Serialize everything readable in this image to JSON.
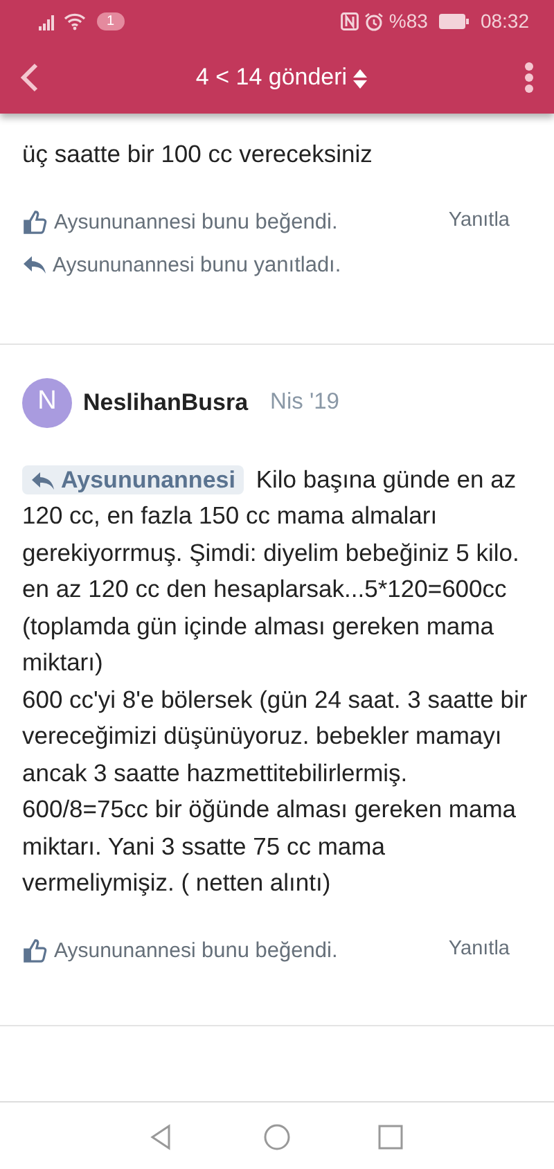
{
  "status_bar": {
    "notification_count": "1",
    "battery": "%83",
    "time": "08:32"
  },
  "header": {
    "title": "4 < 14 gönderi"
  },
  "posts": [
    {
      "kind": "partial",
      "body": "üç saatte bir 100 cc vereceksiniz",
      "likes": {
        "user": "Aysununannesi",
        "text": "bunu beğendi."
      },
      "reply_label": "Yanıtla",
      "replied": {
        "user": "Aysununannesi",
        "text": "bunu yanıtladı."
      }
    },
    {
      "kind": "full",
      "avatar_letter": "N",
      "color": "#a99bdf",
      "author": "NeslihanBusra",
      "date": "Nis '19",
      "quote_user": "Aysununannesi",
      "body": [
        "Kilo başına günde en az 120 cc, en fazla 150 cc mama almaları gerekiyorrmuş. Şimdi: diyelim bebeğiniz 5 kilo. en az 120 cc den hesaplarsak...5*120=600cc (toplamda gün içinde alması gereken mama miktarı)",
        "600 cc'yi 8'e bölersek (gün 24 saat. 3 saatte bir vereceğimizi düşünüyoruz. bebekler mamayı ancak 3 saatte hazmettitebilirlermiş. 600/8=75cc bir öğünde alması gereken mama miktarı. Yani 3 ssatte 75 cc mama vermeliymişiz. ( netten alıntı)"
      ],
      "likes": {
        "user": "Aysununannesi",
        "text": "bunu beğendi."
      },
      "reply_label": "Yanıtla"
    }
  ]
}
